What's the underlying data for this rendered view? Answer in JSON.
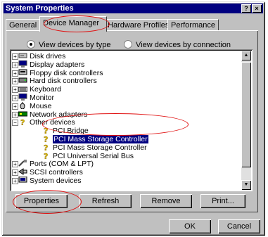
{
  "window": {
    "title": "System Properties",
    "help_glyph": "?",
    "close_glyph": "×"
  },
  "tabs": [
    "General",
    "Device Manager",
    "Hardware Profiles",
    "Performance"
  ],
  "radios": {
    "by_type": "View devices by type",
    "by_connection": "View devices by connection",
    "selected": "by_type"
  },
  "tree": [
    {
      "label": "Disk drives",
      "icon": "disk-icon",
      "expander": "+"
    },
    {
      "label": "Display adapters",
      "icon": "monitor-icon",
      "expander": "+"
    },
    {
      "label": "Floppy disk controllers",
      "icon": "floppy-icon",
      "expander": "+"
    },
    {
      "label": "Hard disk controllers",
      "icon": "harddisk-icon",
      "expander": "+"
    },
    {
      "label": "Keyboard",
      "icon": "keyboard-icon",
      "expander": "+"
    },
    {
      "label": "Monitor",
      "icon": "monitor-icon",
      "expander": "+"
    },
    {
      "label": "Mouse",
      "icon": "mouse-icon",
      "expander": "+"
    },
    {
      "label": "Network adapters",
      "icon": "network-icon",
      "expander": "+"
    },
    {
      "label": "Other devices",
      "icon": "question-icon",
      "expander": "-"
    },
    {
      "label": "PCI Bridge",
      "icon": "question-icon",
      "expander": ""
    },
    {
      "label": "PCI Mass Storage Controller",
      "icon": "question-icon",
      "expander": "",
      "selected": true
    },
    {
      "label": "PCI Mass Storage Controller",
      "icon": "question-icon",
      "expander": ""
    },
    {
      "label": "PCI Universal Serial Bus",
      "icon": "question-icon",
      "expander": ""
    },
    {
      "label": "Ports (COM & LPT)",
      "icon": "port-icon",
      "expander": "+"
    },
    {
      "label": "SCSI controllers",
      "icon": "scsi-icon",
      "expander": "+"
    },
    {
      "label": "System devices",
      "icon": "system-icon",
      "expander": "+"
    }
  ],
  "buttons": {
    "properties": "Properties",
    "refresh": "Refresh",
    "remove": "Remove",
    "print": "Print...",
    "ok": "OK",
    "cancel": "Cancel"
  },
  "colors": {
    "annotation": "#e01010",
    "selection": "#000080"
  }
}
